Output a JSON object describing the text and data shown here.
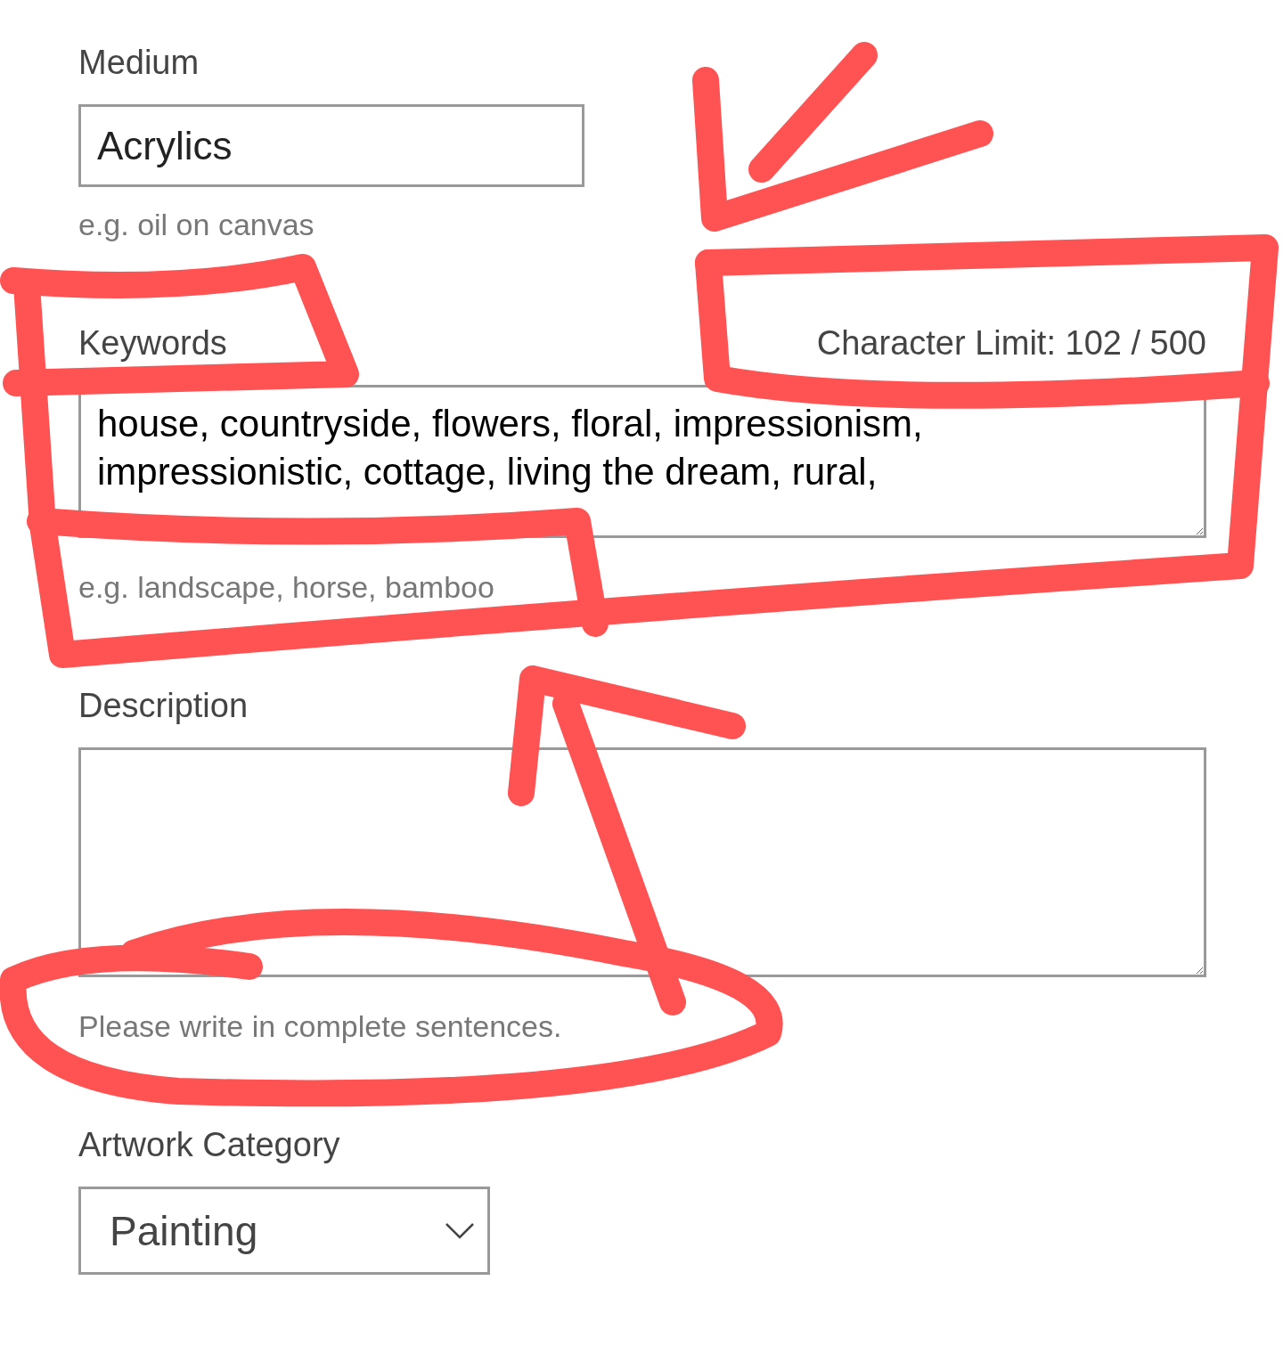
{
  "fields": [
    {
      "kind": "text",
      "label": "Medium",
      "value": "Acrylics",
      "hint": "e.g. oil on canvas"
    },
    {
      "kind": "textarea",
      "label": "Keywords",
      "counter": "Character Limit: 102 / 500",
      "value": "house, countryside, flowers, floral, impressionism, impressionistic, cottage, living the dream, rural,",
      "hint": "e.g. landscape, horse, bamboo"
    },
    {
      "kind": "longtext",
      "label": "Description",
      "hint": "Please write in complete sentences."
    },
    {
      "kind": "select",
      "label": "Artwork Category",
      "value": "Painting"
    }
  ]
}
